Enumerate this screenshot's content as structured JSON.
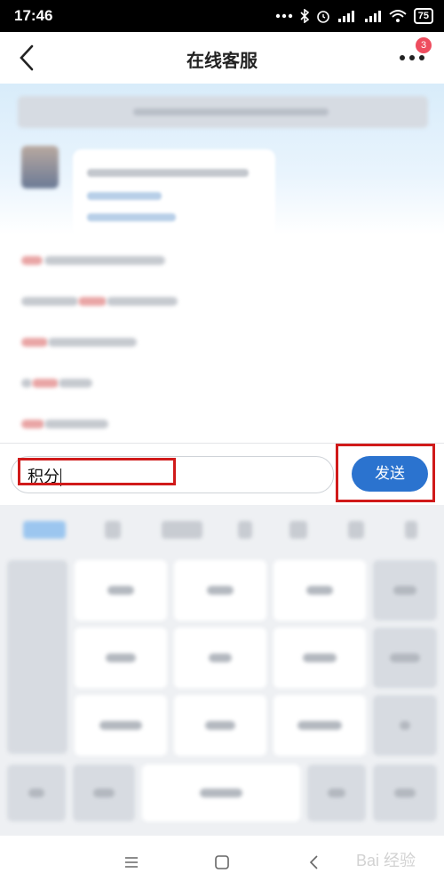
{
  "status_bar": {
    "time": "17:46",
    "battery": "75"
  },
  "header": {
    "title": "在线客服",
    "notification_count": "3"
  },
  "input": {
    "value": "积分"
  },
  "send_button": {
    "label": "发送"
  },
  "watermark": {
    "text": "Bai 经验"
  }
}
